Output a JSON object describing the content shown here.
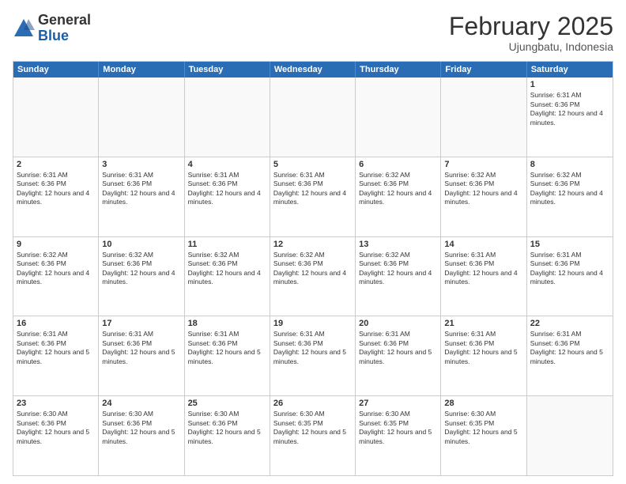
{
  "header": {
    "logo": {
      "general": "General",
      "blue": "Blue"
    },
    "title": "February 2025",
    "location": "Ujungbatu, Indonesia"
  },
  "weekdays": [
    "Sunday",
    "Monday",
    "Tuesday",
    "Wednesday",
    "Thursday",
    "Friday",
    "Saturday"
  ],
  "weeks": [
    [
      {
        "day": "",
        "empty": true
      },
      {
        "day": "",
        "empty": true
      },
      {
        "day": "",
        "empty": true
      },
      {
        "day": "",
        "empty": true
      },
      {
        "day": "",
        "empty": true
      },
      {
        "day": "",
        "empty": true
      },
      {
        "day": "1",
        "sunrise": "Sunrise: 6:31 AM",
        "sunset": "Sunset: 6:36 PM",
        "daylight": "Daylight: 12 hours and 4 minutes."
      }
    ],
    [
      {
        "day": "2",
        "sunrise": "Sunrise: 6:31 AM",
        "sunset": "Sunset: 6:36 PM",
        "daylight": "Daylight: 12 hours and 4 minutes."
      },
      {
        "day": "3",
        "sunrise": "Sunrise: 6:31 AM",
        "sunset": "Sunset: 6:36 PM",
        "daylight": "Daylight: 12 hours and 4 minutes."
      },
      {
        "day": "4",
        "sunrise": "Sunrise: 6:31 AM",
        "sunset": "Sunset: 6:36 PM",
        "daylight": "Daylight: 12 hours and 4 minutes."
      },
      {
        "day": "5",
        "sunrise": "Sunrise: 6:31 AM",
        "sunset": "Sunset: 6:36 PM",
        "daylight": "Daylight: 12 hours and 4 minutes."
      },
      {
        "day": "6",
        "sunrise": "Sunrise: 6:32 AM",
        "sunset": "Sunset: 6:36 PM",
        "daylight": "Daylight: 12 hours and 4 minutes."
      },
      {
        "day": "7",
        "sunrise": "Sunrise: 6:32 AM",
        "sunset": "Sunset: 6:36 PM",
        "daylight": "Daylight: 12 hours and 4 minutes."
      },
      {
        "day": "8",
        "sunrise": "Sunrise: 6:32 AM",
        "sunset": "Sunset: 6:36 PM",
        "daylight": "Daylight: 12 hours and 4 minutes."
      }
    ],
    [
      {
        "day": "9",
        "sunrise": "Sunrise: 6:32 AM",
        "sunset": "Sunset: 6:36 PM",
        "daylight": "Daylight: 12 hours and 4 minutes."
      },
      {
        "day": "10",
        "sunrise": "Sunrise: 6:32 AM",
        "sunset": "Sunset: 6:36 PM",
        "daylight": "Daylight: 12 hours and 4 minutes."
      },
      {
        "day": "11",
        "sunrise": "Sunrise: 6:32 AM",
        "sunset": "Sunset: 6:36 PM",
        "daylight": "Daylight: 12 hours and 4 minutes."
      },
      {
        "day": "12",
        "sunrise": "Sunrise: 6:32 AM",
        "sunset": "Sunset: 6:36 PM",
        "daylight": "Daylight: 12 hours and 4 minutes."
      },
      {
        "day": "13",
        "sunrise": "Sunrise: 6:32 AM",
        "sunset": "Sunset: 6:36 PM",
        "daylight": "Daylight: 12 hours and 4 minutes."
      },
      {
        "day": "14",
        "sunrise": "Sunrise: 6:31 AM",
        "sunset": "Sunset: 6:36 PM",
        "daylight": "Daylight: 12 hours and 4 minutes."
      },
      {
        "day": "15",
        "sunrise": "Sunrise: 6:31 AM",
        "sunset": "Sunset: 6:36 PM",
        "daylight": "Daylight: 12 hours and 4 minutes."
      }
    ],
    [
      {
        "day": "16",
        "sunrise": "Sunrise: 6:31 AM",
        "sunset": "Sunset: 6:36 PM",
        "daylight": "Daylight: 12 hours and 5 minutes."
      },
      {
        "day": "17",
        "sunrise": "Sunrise: 6:31 AM",
        "sunset": "Sunset: 6:36 PM",
        "daylight": "Daylight: 12 hours and 5 minutes."
      },
      {
        "day": "18",
        "sunrise": "Sunrise: 6:31 AM",
        "sunset": "Sunset: 6:36 PM",
        "daylight": "Daylight: 12 hours and 5 minutes."
      },
      {
        "day": "19",
        "sunrise": "Sunrise: 6:31 AM",
        "sunset": "Sunset: 6:36 PM",
        "daylight": "Daylight: 12 hours and 5 minutes."
      },
      {
        "day": "20",
        "sunrise": "Sunrise: 6:31 AM",
        "sunset": "Sunset: 6:36 PM",
        "daylight": "Daylight: 12 hours and 5 minutes."
      },
      {
        "day": "21",
        "sunrise": "Sunrise: 6:31 AM",
        "sunset": "Sunset: 6:36 PM",
        "daylight": "Daylight: 12 hours and 5 minutes."
      },
      {
        "day": "22",
        "sunrise": "Sunrise: 6:31 AM",
        "sunset": "Sunset: 6:36 PM",
        "daylight": "Daylight: 12 hours and 5 minutes."
      }
    ],
    [
      {
        "day": "23",
        "sunrise": "Sunrise: 6:30 AM",
        "sunset": "Sunset: 6:36 PM",
        "daylight": "Daylight: 12 hours and 5 minutes."
      },
      {
        "day": "24",
        "sunrise": "Sunrise: 6:30 AM",
        "sunset": "Sunset: 6:36 PM",
        "daylight": "Daylight: 12 hours and 5 minutes."
      },
      {
        "day": "25",
        "sunrise": "Sunrise: 6:30 AM",
        "sunset": "Sunset: 6:36 PM",
        "daylight": "Daylight: 12 hours and 5 minutes."
      },
      {
        "day": "26",
        "sunrise": "Sunrise: 6:30 AM",
        "sunset": "Sunset: 6:35 PM",
        "daylight": "Daylight: 12 hours and 5 minutes."
      },
      {
        "day": "27",
        "sunrise": "Sunrise: 6:30 AM",
        "sunset": "Sunset: 6:35 PM",
        "daylight": "Daylight: 12 hours and 5 minutes."
      },
      {
        "day": "28",
        "sunrise": "Sunrise: 6:30 AM",
        "sunset": "Sunset: 6:35 PM",
        "daylight": "Daylight: 12 hours and 5 minutes."
      },
      {
        "day": "",
        "empty": true
      }
    ]
  ]
}
